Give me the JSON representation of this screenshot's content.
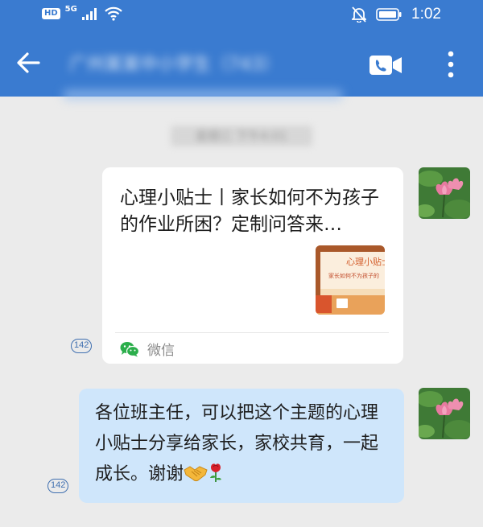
{
  "status_bar": {
    "hd": "HD",
    "network": "5G",
    "time": "1:02"
  },
  "header": {
    "title": "广州某某中小学生（743）"
  },
  "chat": {
    "timestamp": "星期三 下午4:01",
    "messages": [
      {
        "type": "link-card",
        "title": "心理小贴士丨家长如何不为孩子的作业所困？定制问答来…",
        "thumbnail": {
          "heading": "心理小贴士",
          "subtitle": "家长如何不为孩子的"
        },
        "source": "微信",
        "read_count": "142"
      },
      {
        "type": "text",
        "text": "各位班主任，可以把这个主题的心理小贴士分享给家长，家校共育，一起成长。谢谢",
        "emojis": [
          "handshake-emoji",
          "rose-emoji"
        ],
        "read_count": "142"
      }
    ]
  },
  "colors": {
    "header": "#3a7bd0",
    "background": "#ebebeb",
    "bubble": "#cfe6fb",
    "read_badge": "#3f6fb0",
    "wechat_green": "#2bae4b"
  }
}
